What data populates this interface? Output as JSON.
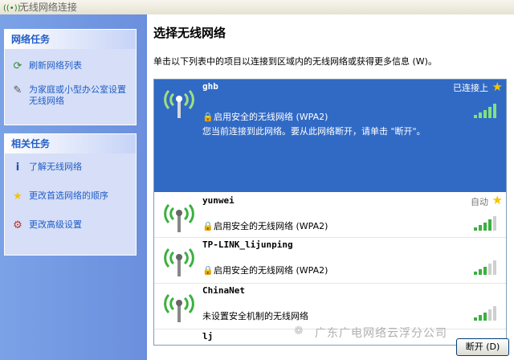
{
  "window": {
    "title": "无线网络连接"
  },
  "sidebar": {
    "network_tasks": {
      "title": "网络任务",
      "items": [
        {
          "label": "刷新网络列表",
          "icon": "refresh-icon"
        },
        {
          "label": "为家庭或小型办公室设置无线网络",
          "icon": "setup-network-icon"
        }
      ]
    },
    "related_tasks": {
      "title": "相关任务",
      "items": [
        {
          "label": "了解无线网络",
          "icon": "info-icon"
        },
        {
          "label": "更改首选网络的顺序",
          "icon": "star-icon"
        },
        {
          "label": "更改高级设置",
          "icon": "settings-icon"
        }
      ]
    }
  },
  "main": {
    "title": "选择无线网络",
    "instruction": "单击以下列表中的项目以连接到区域内的无线网络或获得更多信息 (W)。"
  },
  "networks": [
    {
      "ssid": "ghb",
      "security": "启用安全的无线网络 (WPA2)",
      "status": "已连接上",
      "message": "您当前连接到此网络。要从此网络断开，请单击 \"断开\"。",
      "signal_bars": 5,
      "selected": true,
      "secured": true,
      "preferred": true
    },
    {
      "ssid": "yunwei",
      "security": "启用安全的无线网络 (WPA2)",
      "status": "自动",
      "signal_bars": 4,
      "secured": true,
      "preferred": true
    },
    {
      "ssid": "TP-LINK_lijunping",
      "security": "启用安全的无线网络 (WPA2)",
      "status": "",
      "signal_bars": 3,
      "secured": true,
      "preferred": false
    },
    {
      "ssid": "ChinaNet",
      "security": "未设置安全机制的无线网络",
      "status": "",
      "signal_bars": 3,
      "secured": false,
      "preferred": false
    },
    {
      "ssid": "lj",
      "security": "",
      "status": "",
      "signal_bars": 0,
      "secured": false,
      "preferred": false
    }
  ],
  "footer": {
    "watermark": "广东广电网络云浮分公司",
    "disconnect_button": "断开 (D)"
  },
  "colors": {
    "selected_bg": "#316ac5",
    "signal_bar": "#3cb040",
    "star": "#f5c400",
    "link": "#215dc6"
  }
}
